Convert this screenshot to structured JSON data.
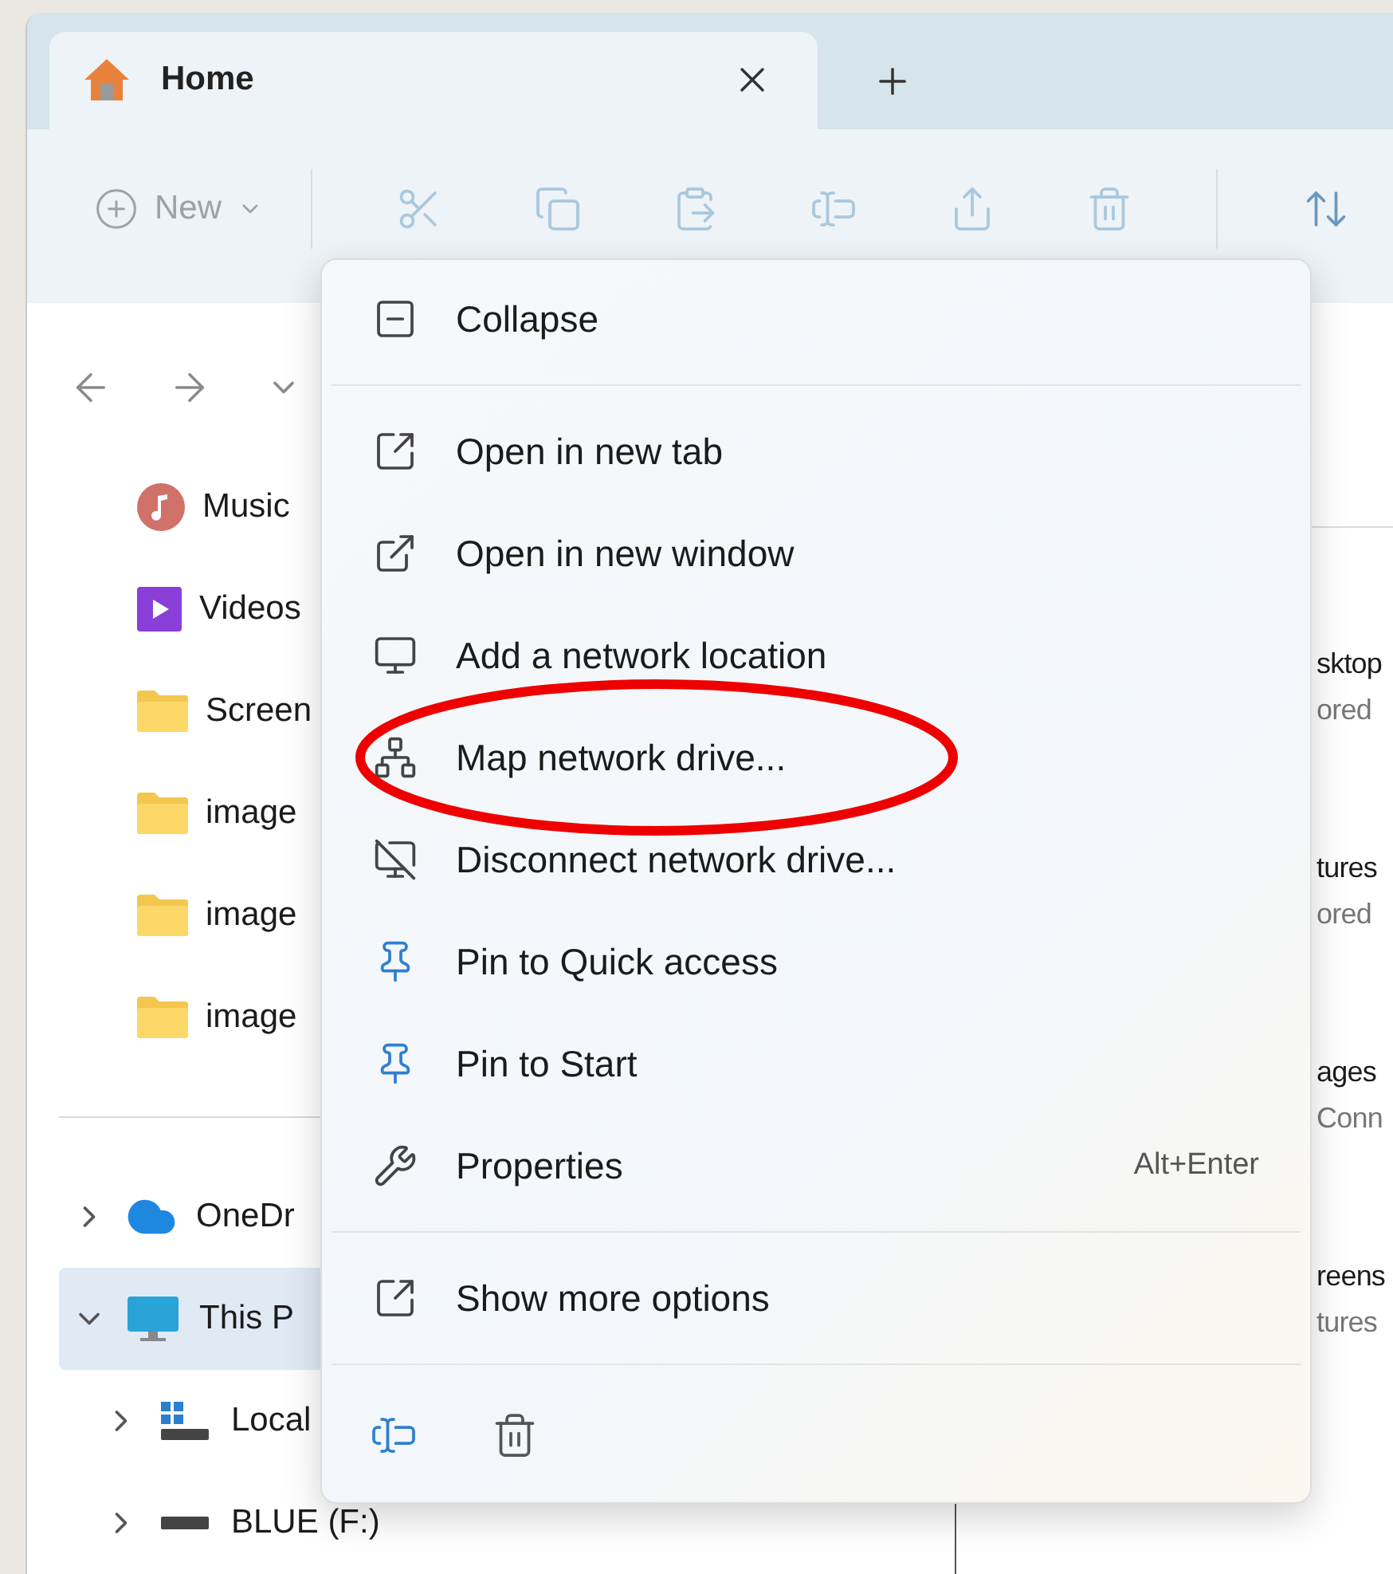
{
  "tabs": [
    {
      "label": "Home",
      "selected": true
    }
  ],
  "toolbar": {
    "new_button": {
      "label": "New",
      "disabled": true
    },
    "actions": [
      {
        "kind": "cut",
        "disabled": true
      },
      {
        "kind": "copy",
        "disabled": true
      },
      {
        "kind": "paste",
        "disabled": true
      },
      {
        "kind": "rename",
        "disabled": true
      },
      {
        "kind": "share",
        "disabled": true
      },
      {
        "kind": "delete",
        "disabled": true
      },
      {
        "kind": "sort",
        "disabled": false
      }
    ]
  },
  "sidebar": {
    "quick_access": [
      {
        "label": "Music",
        "kind": "music"
      },
      {
        "label": "Videos",
        "kind": "videos"
      },
      {
        "label": "Screen",
        "kind": "folder"
      },
      {
        "label": "image",
        "kind": "folder"
      },
      {
        "label": "image",
        "kind": "folder"
      },
      {
        "label": "image",
        "kind": "folder"
      }
    ],
    "tree": [
      {
        "label": "OneDr",
        "kind": "cloud",
        "expanded": false,
        "selected": false
      },
      {
        "label": "This P",
        "kind": "pc",
        "expanded": true,
        "selected": true,
        "children": [
          {
            "label": "Local",
            "kind": "disk",
            "expanded": false,
            "selected": false
          },
          {
            "label": "BLUE (F:)",
            "kind": "drive",
            "expanded": false,
            "selected": false
          }
        ]
      }
    ]
  },
  "right_pane": {
    "items": [
      {
        "name": "sktop",
        "detail": "ored"
      },
      {
        "name": "tures",
        "detail": "ored"
      },
      {
        "name": "ages",
        "detail": "Conn"
      },
      {
        "name": "reens",
        "detail": "tures"
      }
    ]
  },
  "context_menu": {
    "items": [
      {
        "kind": "collapse",
        "label": "Collapse",
        "circled": false
      },
      {
        "kind": "separator"
      },
      {
        "kind": "new-tab",
        "label": "Open in new tab",
        "circled": false
      },
      {
        "kind": "new-window",
        "label": "Open in new window",
        "circled": false
      },
      {
        "kind": "network",
        "label": "Add a network location",
        "circled": false
      },
      {
        "kind": "map-drive",
        "label": "Map network drive...",
        "circled": true
      },
      {
        "kind": "disconnect",
        "label": "Disconnect network drive...",
        "circled": false
      },
      {
        "kind": "pin",
        "label": "Pin to Quick access",
        "circled": false
      },
      {
        "kind": "pin",
        "label": "Pin to Start",
        "circled": false
      },
      {
        "kind": "wrench",
        "label": "Properties",
        "shortcut": "Alt+Enter",
        "circled": false
      },
      {
        "kind": "separator"
      },
      {
        "kind": "more",
        "label": "Show more options",
        "circled": false
      },
      {
        "kind": "separator"
      },
      {
        "kind": "actions",
        "actions": [
          {
            "kind": "rename"
          },
          {
            "kind": "delete"
          }
        ]
      }
    ]
  }
}
